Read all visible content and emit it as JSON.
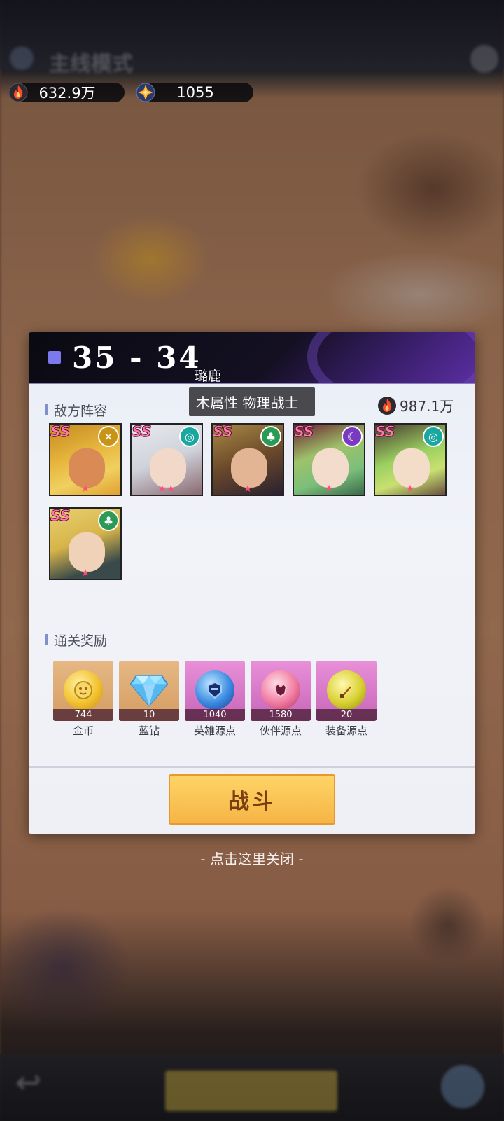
{
  "topbar": {
    "mode_title": "主线模式",
    "power": "632.9万",
    "diamonds": "1055"
  },
  "dialog": {
    "stage_title": "35 - 34",
    "enemy_section_label": "敌方阵容",
    "enemy_power": "987.1万",
    "tooltip": {
      "name": "璐鹿",
      "description": "木属性 物理战士"
    },
    "enemies": [
      {
        "grade": "SS",
        "element": "light-icon",
        "color": "#d9a020"
      },
      {
        "grade": "SS",
        "element": "water-icon",
        "color": "#1aa7a0"
      },
      {
        "grade": "SS",
        "element": "wood-icon",
        "color": "#2a9a55"
      },
      {
        "grade": "SS",
        "element": "dark-icon",
        "color": "#7a3ac0"
      },
      {
        "grade": "SS",
        "element": "water-icon",
        "color": "#1aa7a0"
      },
      {
        "grade": "SS",
        "element": "wood-icon",
        "color": "#2a9a55"
      }
    ],
    "rewards_section_label": "通关奖励",
    "rewards": [
      {
        "qty": "744",
        "name": "金币",
        "icon": "coin-icon"
      },
      {
        "qty": "10",
        "name": "蓝钻",
        "icon": "diamond-icon"
      },
      {
        "qty": "1040",
        "name": "英雄源点",
        "icon": "hero-essence-icon"
      },
      {
        "qty": "1580",
        "name": "伙伴源点",
        "icon": "partner-essence-icon"
      },
      {
        "qty": "20",
        "name": "装备源点",
        "icon": "equipment-essence-icon"
      }
    ],
    "fight_button": "战斗",
    "close_hint": "- 点击这里关闭 -"
  },
  "colors": {
    "accent": "#7c78ee",
    "fight_button": "#f8c152",
    "grade_text": "#ff7ab0"
  }
}
